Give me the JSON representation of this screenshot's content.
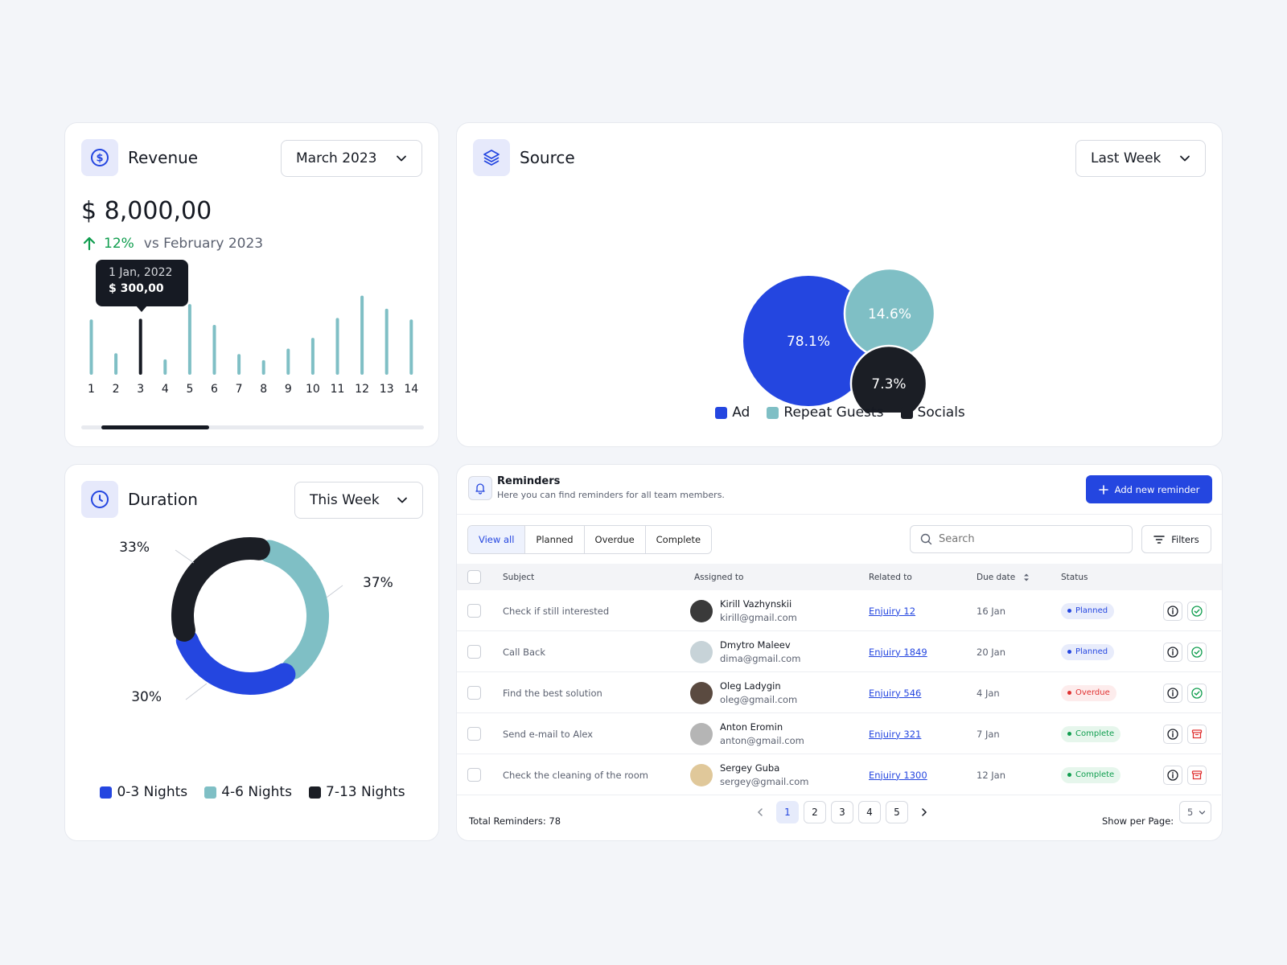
{
  "revenue": {
    "title": "Revenue",
    "period": "March 2023",
    "total": "$ 8,000,00",
    "change": "12%",
    "compare": "vs February 2023",
    "tooltip_date": "1 Jan, 2022",
    "tooltip_value": "$ 300,00",
    "colors": {
      "bar": "#7fbfc5",
      "highlight": "#161a23",
      "up": "#0f9d4e"
    }
  },
  "chart_data": [
    {
      "type": "bar",
      "categories": [
        "1",
        "2",
        "3",
        "4",
        "5",
        "6",
        "7",
        "8",
        "9",
        "10",
        "11",
        "12",
        "13",
        "14"
      ],
      "values": [
        72,
        28,
        73,
        20,
        92,
        65,
        27,
        19,
        34,
        48,
        74,
        103,
        86,
        72
      ],
      "highlight_index": 2,
      "title": "",
      "xlabel": "",
      "ylabel": "",
      "ylim": [
        0,
        110
      ],
      "grid": false
    },
    {
      "type": "pie",
      "categories": [
        "Ad",
        "Repeat Guests",
        "Socials"
      ],
      "values": [
        78.1,
        14.6,
        7.3
      ],
      "labels": [
        "78.1%",
        "14.6%",
        "7.3%"
      ],
      "colors": [
        "#2446e0",
        "#7fbfc5",
        "#1b1e25"
      ],
      "legend": "bottom"
    },
    {
      "type": "pie",
      "categories": [
        "0-3 Nights",
        "4-6 Nights",
        "7-13 Nights"
      ],
      "values": [
        30,
        37,
        33
      ],
      "labels": [
        "30%",
        "37%",
        "33%"
      ],
      "colors": [
        "#2446e0",
        "#7fbfc5",
        "#1b1e25"
      ],
      "legend": "bottom"
    }
  ],
  "source": {
    "title": "Source",
    "period": "Last Week",
    "legend": [
      "Ad",
      "Repeat Guests",
      "Socials"
    ]
  },
  "duration": {
    "title": "Duration",
    "period": "This Week",
    "legend": [
      "0-3 Nights",
      "4-6 Nights",
      "7-13 Nights"
    ]
  },
  "reminders": {
    "title": "Reminders",
    "subtitle": "Here you can find reminders for all team members.",
    "add_label": "Add new reminder",
    "tabs": [
      "View all",
      "Planned",
      "Overdue",
      "Complete"
    ],
    "search_placeholder": "Search",
    "filters_label": "Filters",
    "columns": [
      "Subject",
      "Assigned to",
      "Related to",
      "Due date",
      "Status"
    ],
    "rows": [
      {
        "subject": "Check if still interested",
        "name": "Kirill Vazhynskii",
        "email": "kirill@gmail.com",
        "related": "Enjuiry 12",
        "due": "16 Jan",
        "status": "Planned"
      },
      {
        "subject": "Call Back",
        "name": "Dmytro Maleev",
        "email": "dima@gmail.com",
        "related": "Enjuiry 1849",
        "due": "20 Jan",
        "status": "Planned"
      },
      {
        "subject": "Find the best solution",
        "name": "Oleg Ladygin",
        "email": "oleg@gmail.com",
        "related": "Enjuiry 546",
        "due": "4 Jan",
        "status": "Overdue"
      },
      {
        "subject": "Send e-mail to Alex",
        "name": "Anton Eromin",
        "email": "anton@gmail.com",
        "related": "Enjuiry 321",
        "due": "7 Jan",
        "status": "Complete"
      },
      {
        "subject": "Check the cleaning of the room",
        "name": "Sergey Guba",
        "email": "sergey@gmail.com",
        "related": "Enjuiry 1300",
        "due": "12 Jan",
        "status": "Complete"
      }
    ],
    "total_label": "Total Reminders: 78",
    "pages": [
      "1",
      "2",
      "3",
      "4",
      "5"
    ],
    "per_page_label": "Show per Page:",
    "per_page_value": "5",
    "status_colors": {
      "Planned": {
        "bg": "#e8ecfb",
        "fg": "#2446e0"
      },
      "Overdue": {
        "bg": "#fdecec",
        "fg": "#e03131"
      },
      "Complete": {
        "bg": "#e6f6ec",
        "fg": "#0f9d4e"
      }
    }
  }
}
